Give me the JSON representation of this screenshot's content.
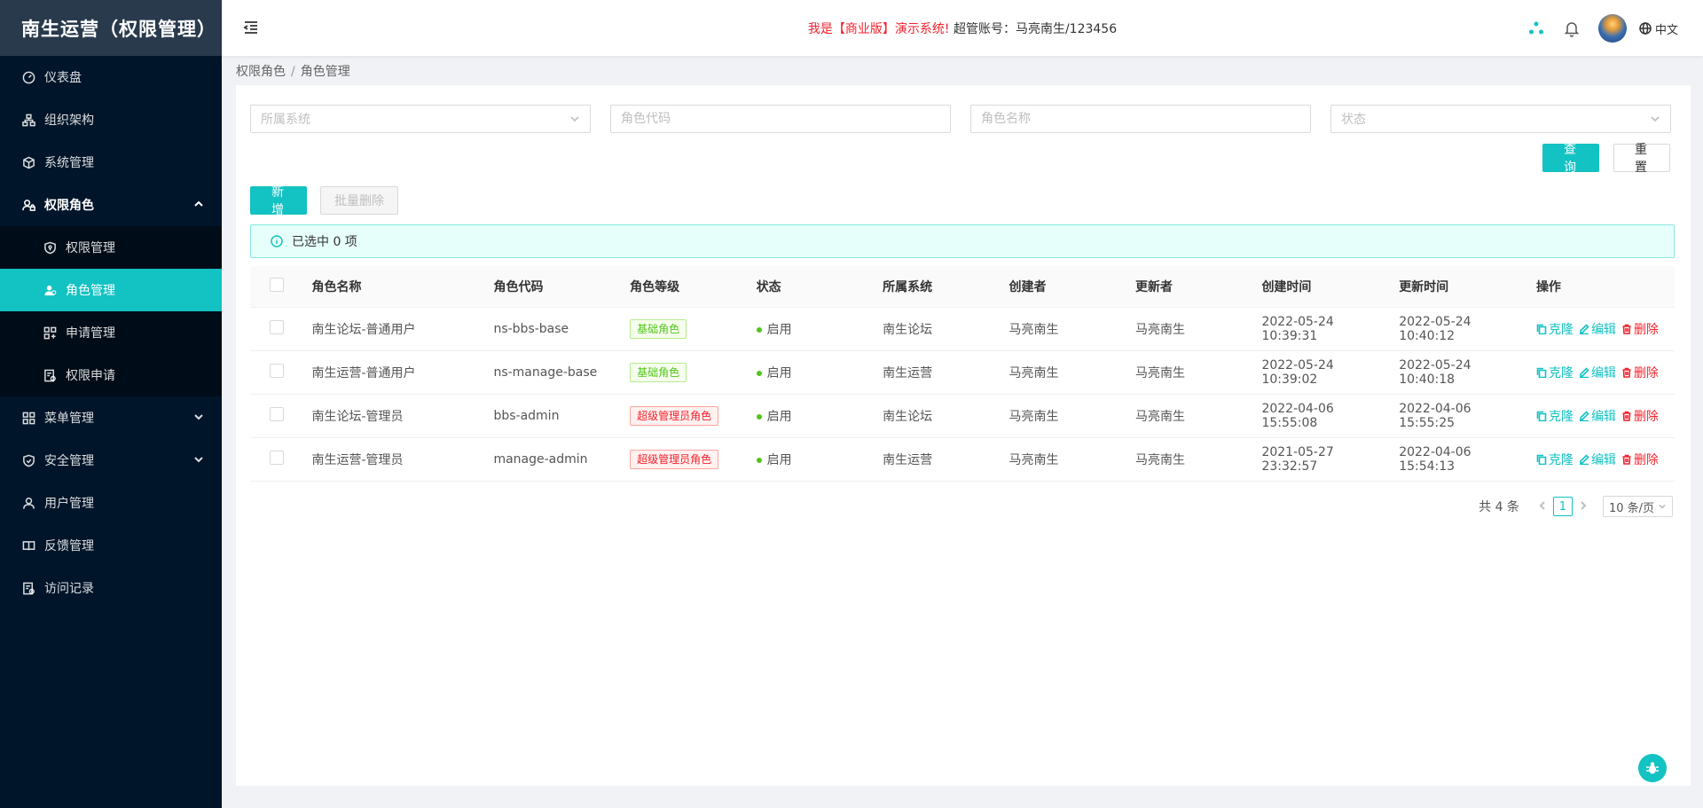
{
  "app": {
    "title": "南生运营（权限管理）"
  },
  "sidebar": {
    "items": [
      {
        "label": "仪表盘",
        "icon": "dashboard-icon"
      },
      {
        "label": "组织架构",
        "icon": "org-chart-icon"
      },
      {
        "label": "系统管理",
        "icon": "cube-icon"
      },
      {
        "label": "权限角色",
        "icon": "user-lock-icon",
        "expanded": true
      },
      {
        "label": "菜单管理",
        "icon": "grid-icon",
        "expandable": true
      },
      {
        "label": "安全管理",
        "icon": "shield-icon",
        "expandable": true
      },
      {
        "label": "用户管理",
        "icon": "user-icon"
      },
      {
        "label": "反馈管理",
        "icon": "book-icon"
      },
      {
        "label": "访问记录",
        "icon": "log-icon"
      }
    ],
    "sub_items": [
      {
        "label": "权限管理",
        "icon": "shield-key-icon"
      },
      {
        "label": "角色管理",
        "icon": "users-icon",
        "active": true
      },
      {
        "label": "申请管理",
        "icon": "apps-icon"
      },
      {
        "label": "权限申请",
        "icon": "form-icon"
      }
    ]
  },
  "header": {
    "notice_red": "我是【商业版】演示系统!",
    "notice_black": " 超管账号：马亮南生/123456",
    "lang": "中文"
  },
  "breadcrumb": {
    "parent": "权限角色",
    "sep": "/",
    "current": "角色管理"
  },
  "filters": {
    "system_placeholder": "所属系统",
    "code_placeholder": "角色代码",
    "name_placeholder": "角色名称",
    "status_placeholder": "状态"
  },
  "buttons": {
    "query": "查 询",
    "reset": "重 置",
    "add": "新 增",
    "batch_delete": "批量删除"
  },
  "alert": {
    "text": "已选中 0 项"
  },
  "table": {
    "headers": [
      "角色名称",
      "角色代码",
      "角色等级",
      "状态",
      "所属系统",
      "创建者",
      "更新者",
      "创建时间",
      "更新时间",
      "操作"
    ],
    "rows": [
      {
        "name": "南生论坛-普通用户",
        "code": "ns-bbs-base",
        "level": "基础角色",
        "level_type": "green",
        "status": "启用",
        "system": "南生论坛",
        "creator": "马亮南生",
        "updater": "马亮南生",
        "created": "2022-05-24 10:39:31",
        "updated": "2022-05-24 10:40:12"
      },
      {
        "name": "南生运营-普通用户",
        "code": "ns-manage-base",
        "level": "基础角色",
        "level_type": "green",
        "status": "启用",
        "system": "南生运营",
        "creator": "马亮南生",
        "updater": "马亮南生",
        "created": "2022-05-24 10:39:02",
        "updated": "2022-05-24 10:40:18"
      },
      {
        "name": "南生论坛-管理员",
        "code": "bbs-admin",
        "level": "超级管理员角色",
        "level_type": "red",
        "status": "启用",
        "system": "南生论坛",
        "creator": "马亮南生",
        "updater": "马亮南生",
        "created": "2022-04-06 15:55:08",
        "updated": "2022-04-06 15:55:25"
      },
      {
        "name": "南生运营-管理员",
        "code": "manage-admin",
        "level": "超级管理员角色",
        "level_type": "red",
        "status": "启用",
        "system": "南生运营",
        "creator": "马亮南生",
        "updater": "马亮南生",
        "created": "2021-05-27 23:32:57",
        "updated": "2022-04-06 15:54:13"
      }
    ],
    "actions": {
      "clone": "克隆",
      "edit": "编辑",
      "delete": "删除"
    }
  },
  "pagination": {
    "total": "共 4 条",
    "current": "1",
    "page_size": "10 条/页"
  },
  "colors": {
    "accent": "#13c2c2",
    "sidebar_bg": "#001529",
    "danger": "#f5222d",
    "success": "#52c41a"
  }
}
